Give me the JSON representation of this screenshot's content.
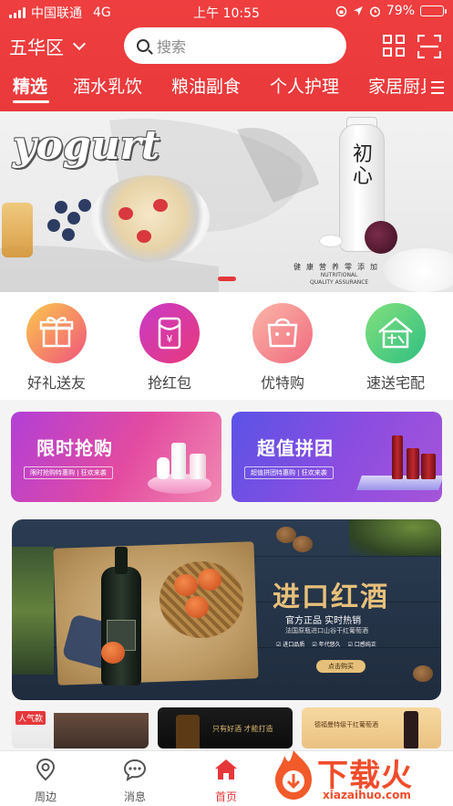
{
  "status_bar": {
    "carrier": "中国联通",
    "network": "4G",
    "time": "上午 10:55",
    "battery": "79%",
    "battery_level": 0.79
  },
  "header": {
    "city": "五华区",
    "search_placeholder": "搜索"
  },
  "tabs": [
    {
      "label": "精选",
      "active": true
    },
    {
      "label": "酒水乳饮",
      "active": false
    },
    {
      "label": "粮油副食",
      "active": false
    },
    {
      "label": "个人护理",
      "active": false
    },
    {
      "label": "家居厨具",
      "active": false
    }
  ],
  "banner": {
    "brand_text": "yogurt",
    "product_label": "初心",
    "slogan": "健康营养零添加",
    "quality_line1": "NUTRITIONAL",
    "quality_line2": "QUALITY ASSURANCE"
  },
  "quick_links": [
    {
      "label": "好礼送友",
      "icon": "gift-icon",
      "color_from": "#fbc84c",
      "color_to": "#f0537d"
    },
    {
      "label": "抢红包",
      "icon": "red-envelope-icon",
      "color_from": "#c83ac8",
      "color_to": "#e8397a"
    },
    {
      "label": "优特购",
      "icon": "shopping-bag-icon",
      "color_from": "#fbb6a8",
      "color_to": "#f06a7e"
    },
    {
      "label": "速送宅配",
      "icon": "home-delivery-icon",
      "color_from": "#83e07c",
      "color_to": "#2fbf82"
    }
  ],
  "promos": [
    {
      "title": "限时抢购",
      "sub": "限时抢购特惠购 | 狂欢来袭"
    },
    {
      "title": "超值拼团",
      "sub": "超值拼团特惠购 | 狂欢来袭"
    }
  ],
  "wine_banner": {
    "title": "进口红酒",
    "line1": "官方正品  实时热销",
    "line2": "法国原瓶进口山谷干红葡萄酒",
    "features": [
      "进口品质",
      "年代悠久",
      "口感纯正"
    ],
    "button": "点击购买"
  },
  "thumbs": {
    "hot_tag": "人气款",
    "thumb2_text": "只有好酒 才能打造",
    "thumb3_text": "德福曼特级干红葡萄酒"
  },
  "bottom_nav": [
    {
      "label": "周边",
      "icon": "location-pin-icon",
      "active": false
    },
    {
      "label": "消息",
      "icon": "chat-bubble-icon",
      "active": false
    },
    {
      "label": "首页",
      "icon": "home-icon",
      "active": true
    }
  ],
  "watermark": {
    "title": "下载火",
    "url": "xiazaihuo.com"
  },
  "colors": {
    "brand_red": "#e9393b",
    "wine_gold": "#e6c07a"
  }
}
